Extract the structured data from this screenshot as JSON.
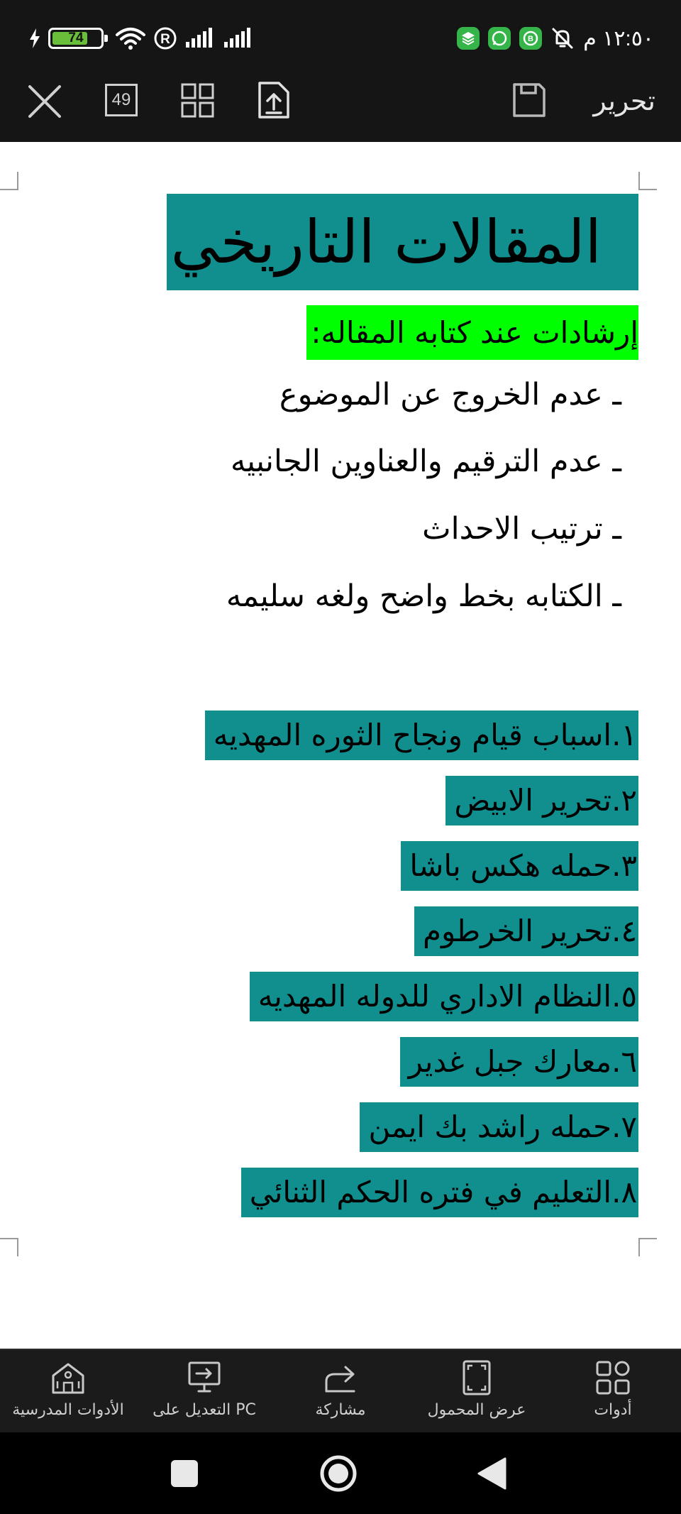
{
  "status_bar": {
    "battery_level": "74",
    "battery_color": "#6abf3a",
    "time": "١٢:٥٠ م",
    "icons": [
      "charging-bolt-icon",
      "wifi-icon",
      "registered-icon",
      "signal-icon",
      "signal-icon",
      "layers-app-icon",
      "whatsapp-icon",
      "whatsapp-business-icon",
      "mute-bell-icon"
    ]
  },
  "toolbar": {
    "edit_label": "تحرير",
    "page_count": "49",
    "icons": [
      "close-icon",
      "page-count-icon",
      "grid-view-icon",
      "share-upload-icon",
      "save-icon"
    ]
  },
  "document": {
    "title": "المقالات التاريخي",
    "subtitle": "إرشادات عند كتابه المقاله:",
    "guidelines": [
      "ـ عدم الخروج عن الموضوع",
      "ـ عدم الترقيم والعناوين الجانبيه",
      "ـ ترتيب الاحداث",
      "ـ الكتابه بخط واضح ولغه سليمه"
    ],
    "topics": [
      "١.اسباب قيام ونجاح الثوره المهديه",
      "٢.تحرير الابيض",
      "٣.حمله هكس باشا",
      "٤.تحرير الخرطوم",
      "٥.النظام الاداري للدوله المهديه",
      "٦.معارك جبل غدير",
      "٧.حمله راشد بك ايمن",
      "٨.التعليم في فتره الحكم الثنائي"
    ],
    "colors": {
      "teal_highlight": "#118f8f",
      "green_highlight": "#00ff00"
    }
  },
  "tab_bar": {
    "tabs": [
      {
        "label": "أدوات",
        "icon": "tools-grid-icon"
      },
      {
        "label": "عرض المحمول",
        "icon": "mobile-view-icon"
      },
      {
        "label": "مشاركة",
        "icon": "share-icon"
      },
      {
        "label": "التعديل على PC",
        "icon": "pc-edit-icon"
      },
      {
        "label": "الأدوات المدرسية",
        "icon": "school-tools-icon"
      }
    ]
  },
  "nav_bar": {
    "icons": [
      "recents-square-icon",
      "home-circle-icon",
      "back-triangle-icon"
    ]
  }
}
